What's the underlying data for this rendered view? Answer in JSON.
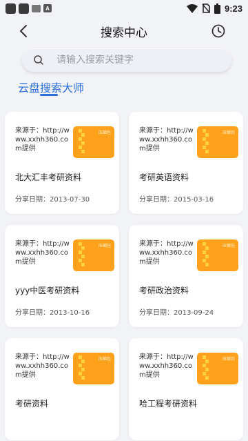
{
  "status_bar": {
    "time": "9:23"
  },
  "header": {
    "title": "搜索中心"
  },
  "search": {
    "placeholder": "请输入搜索关键字"
  },
  "tabs": [
    {
      "label": "云盘搜索大师"
    }
  ],
  "thumbnail_label": "压缩包",
  "cards": [
    {
      "source": "来源于：http://www.xxhh360.com提供",
      "title": "北大汇丰考研资料",
      "date": "分享日期：2013-07-30"
    },
    {
      "source": "来源于：http://www.xxhh360.com提供",
      "title": "考研英语资料",
      "date": "分享日期：2015-03-16"
    },
    {
      "source": "来源于：http://www.xxhh360.com提供",
      "title": "yyy中医考研资料",
      "date": "分享日期：2013-10-16"
    },
    {
      "source": "来源于：http://www.xxhh360.com提供",
      "title": "考研政治资料",
      "date": "分享日期：2013-09-24"
    },
    {
      "source": "来源于：http://www.xxhh360.com提供",
      "title": "考研资料",
      "date": ""
    },
    {
      "source": "来源于：http://www.xxhh360.com提供",
      "title": "哈工程考研资料",
      "date": ""
    }
  ]
}
